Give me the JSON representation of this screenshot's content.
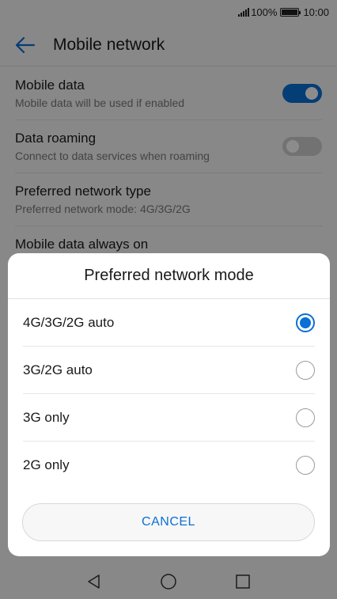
{
  "status_bar": {
    "battery_percent": "100%",
    "time": "10:00",
    "icons": [
      "signal-icon",
      "battery-icon"
    ]
  },
  "app_bar": {
    "title": "Mobile network",
    "back_icon": "arrow-left-icon"
  },
  "settings": [
    {
      "title": "Mobile data",
      "subtitle": "Mobile data will be used if enabled",
      "toggle": "on"
    },
    {
      "title": "Data roaming",
      "subtitle": "Connect to data services when roaming",
      "toggle": "off"
    },
    {
      "title": "Preferred network type",
      "subtitle": "Preferred network mode: 4G/3G/2G"
    },
    {
      "title": "Mobile data always on",
      "subtitle": "",
      "toggle": "on"
    }
  ],
  "dialog": {
    "title": "Preferred network mode",
    "options": [
      {
        "label": "4G/3G/2G auto",
        "selected": true
      },
      {
        "label": "3G/2G auto",
        "selected": false
      },
      {
        "label": "3G only",
        "selected": false
      },
      {
        "label": "2G only",
        "selected": false
      }
    ],
    "cancel_label": "CANCEL"
  },
  "nav_bar": {
    "icons": [
      "back-triangle-icon",
      "home-circle-icon",
      "recents-square-icon"
    ]
  },
  "colors": {
    "accent": "#0a6fd6",
    "background": "#f7f7f7",
    "scrim": "rgba(0,0,0,0.45)"
  }
}
